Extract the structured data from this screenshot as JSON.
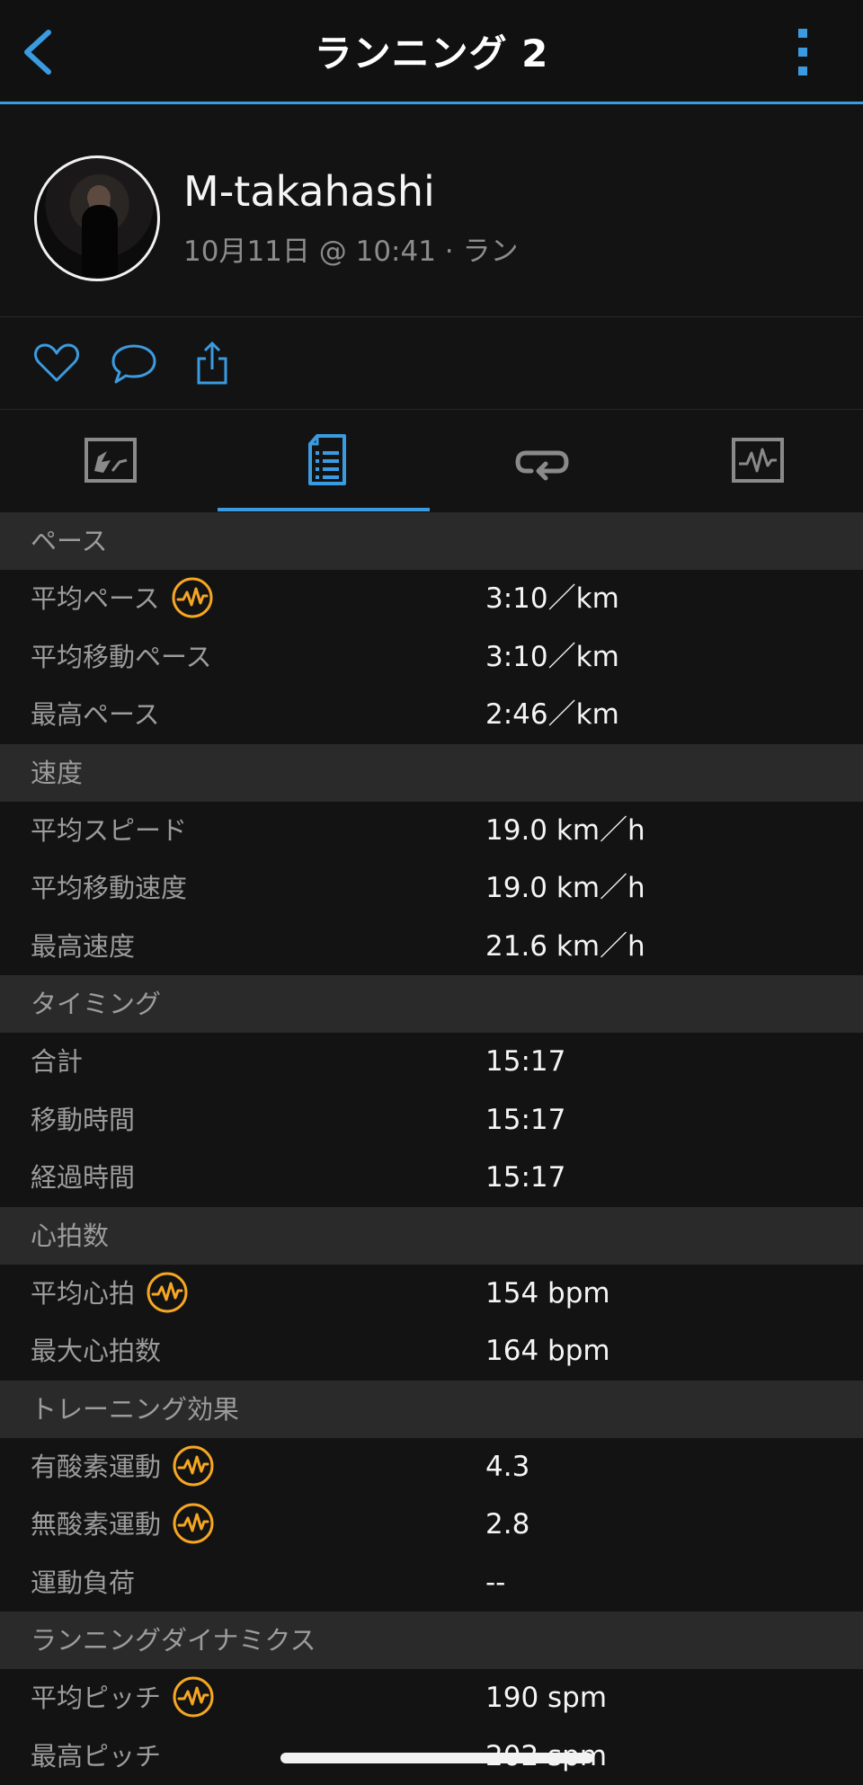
{
  "header": {
    "title": "ランニング 2",
    "back_icon": "chevron-left-icon",
    "more_icon": "vertical-dots-icon",
    "accent_color": "#3b9be0"
  },
  "profile": {
    "name": "M-takahashi",
    "meta": "10月11日 @ 10:41 · ラン"
  },
  "actions": [
    {
      "icon": "heart-icon"
    },
    {
      "icon": "comment-icon"
    },
    {
      "icon": "share-icon"
    }
  ],
  "tabs": [
    {
      "icon": "map-icon",
      "active": false
    },
    {
      "icon": "stats-document-icon",
      "active": true
    },
    {
      "icon": "laps-icon",
      "active": false
    },
    {
      "icon": "chart-icon",
      "active": false
    }
  ],
  "sections": [
    {
      "title": "ペース",
      "rows": [
        {
          "label": "平均ペース",
          "value": "3:10／km",
          "badge": true
        },
        {
          "label": "平均移動ペース",
          "value": "3:10／km",
          "badge": false
        },
        {
          "label": "最高ペース",
          "value": "2:46／km",
          "badge": false
        }
      ]
    },
    {
      "title": "速度",
      "rows": [
        {
          "label": "平均スピード",
          "value": "19.0 km／h",
          "badge": false
        },
        {
          "label": "平均移動速度",
          "value": "19.0 km／h",
          "badge": false
        },
        {
          "label": "最高速度",
          "value": "21.6 km／h",
          "badge": false
        }
      ]
    },
    {
      "title": "タイミング",
      "rows": [
        {
          "label": "合計",
          "value": "15:17",
          "badge": false
        },
        {
          "label": "移動時間",
          "value": "15:17",
          "badge": false
        },
        {
          "label": "経過時間",
          "value": "15:17",
          "badge": false
        }
      ]
    },
    {
      "title": "心拍数",
      "rows": [
        {
          "label": "平均心拍",
          "value": "154 bpm",
          "badge": true
        },
        {
          "label": "最大心拍数",
          "value": "164 bpm",
          "badge": false
        }
      ]
    },
    {
      "title": "トレーニング効果",
      "rows": [
        {
          "label": "有酸素運動",
          "value": "4.3",
          "badge": true
        },
        {
          "label": "無酸素運動",
          "value": "2.8",
          "badge": true
        },
        {
          "label": "運動負荷",
          "value": "--",
          "badge": false
        }
      ]
    },
    {
      "title": "ランニングダイナミクス",
      "rows": [
        {
          "label": "平均ピッチ",
          "value": "190 spm",
          "badge": true
        },
        {
          "label": "最高ピッチ",
          "value": "202 spm",
          "badge": false
        }
      ]
    }
  ],
  "badge_icon": "heart-rate-badge-icon",
  "badge_color": "#f5a623"
}
